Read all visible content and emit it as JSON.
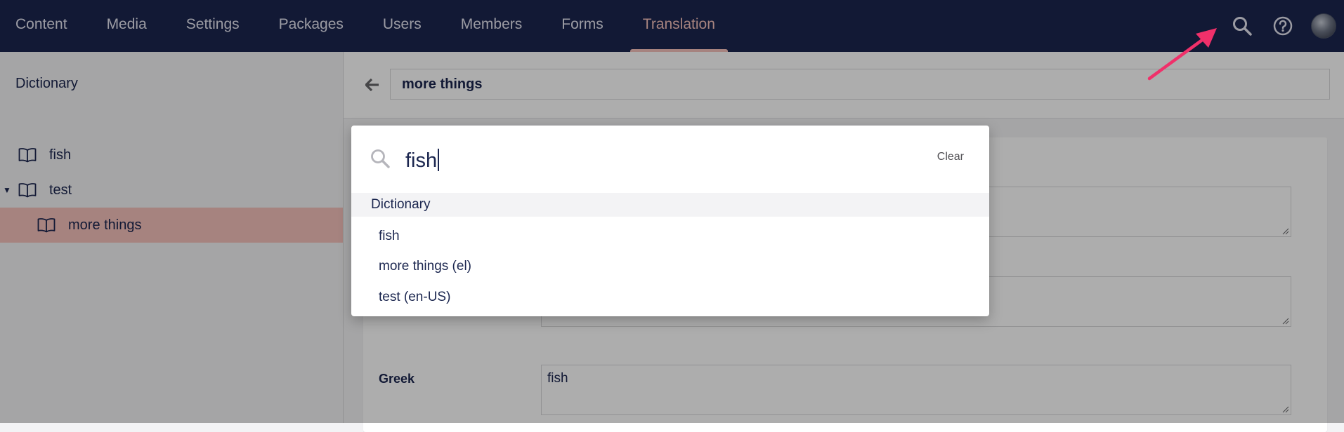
{
  "nav": {
    "items": [
      "Content",
      "Media",
      "Settings",
      "Packages",
      "Users",
      "Members",
      "Forms",
      "Translation"
    ],
    "active_index": 7
  },
  "top_actions": [
    "search-icon",
    "help-icon",
    "avatar"
  ],
  "sidebar": {
    "title": "Dictionary",
    "tree": [
      {
        "label": "fish",
        "icon": "book-icon",
        "level": 0,
        "expanded": false
      },
      {
        "label": "test",
        "icon": "book-icon",
        "level": 0,
        "expanded": true
      },
      {
        "label": "more things",
        "icon": "book-icon",
        "level": 1,
        "selected": true
      }
    ]
  },
  "editor": {
    "name_value": "more things",
    "fields": [
      {
        "label": "",
        "value": ""
      },
      {
        "label": "",
        "value": ""
      },
      {
        "label": "Greek",
        "value": "fish"
      }
    ]
  },
  "search": {
    "query": "fish",
    "clear_label": "Clear",
    "group": "Dictionary",
    "results": [
      "fish",
      "more things (el)",
      "test (en-US)"
    ]
  },
  "colors": {
    "topbar": "#1b264f",
    "active_tab": "#f5c1bc",
    "selected_row": "#f5c1bc",
    "annotation_arrow": "#f0306a"
  }
}
